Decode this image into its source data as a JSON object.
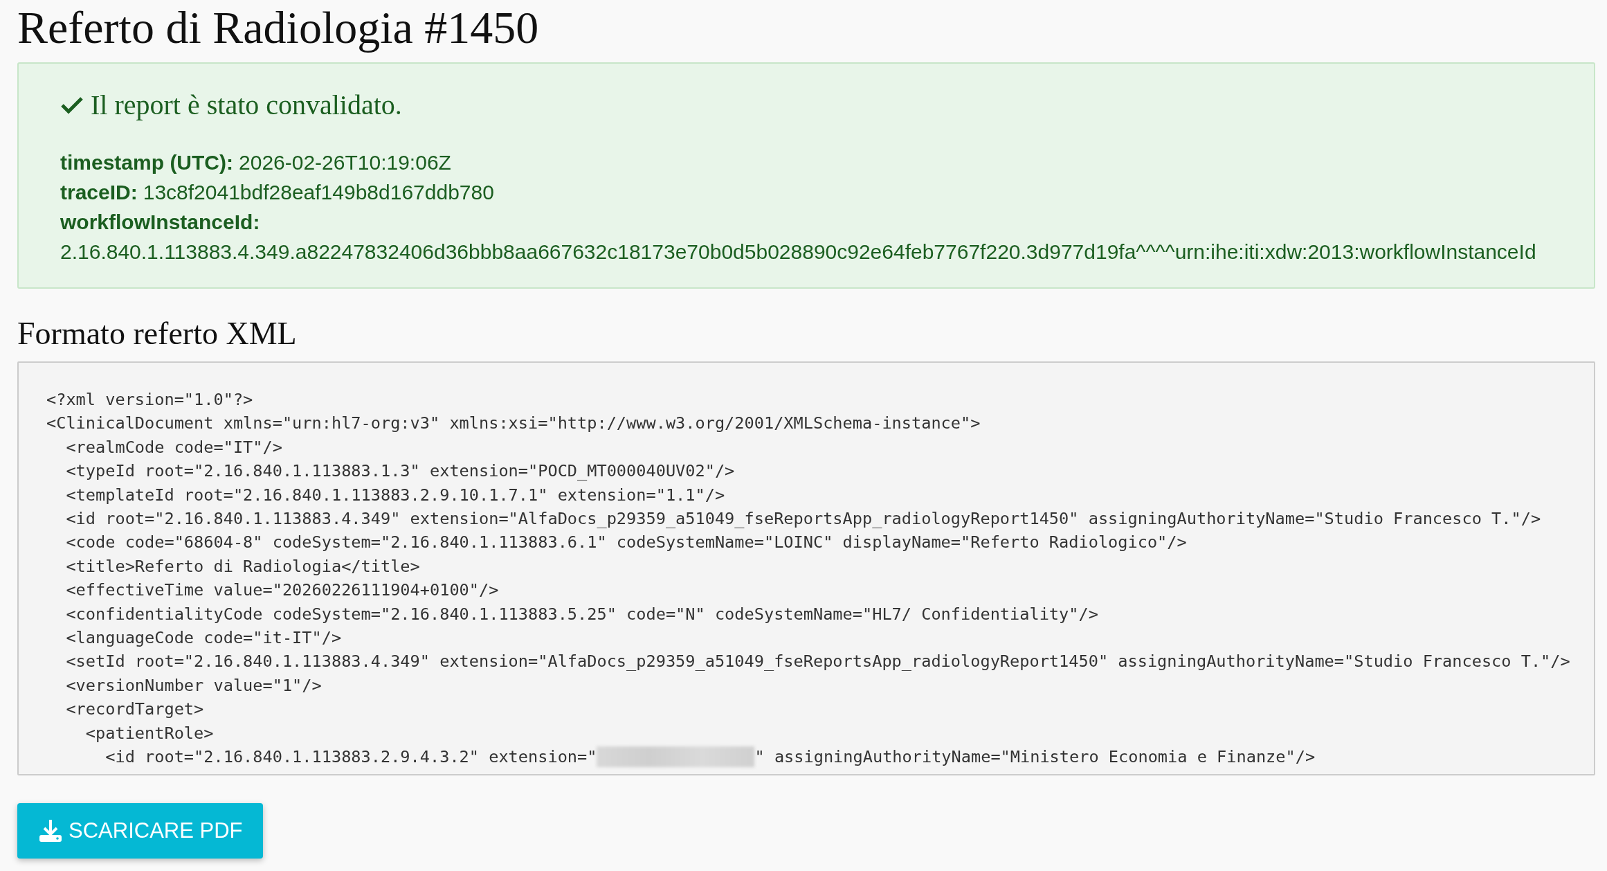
{
  "title": "Referto di Radiologia #1450",
  "alert": {
    "message": "Il report è stato convalidato.",
    "fields": [
      {
        "label": "timestamp (UTC):",
        "value": "2026-02-26T10:19:06Z",
        "wrap": false
      },
      {
        "label": "traceID:",
        "value": "13c8f2041bdf28eaf149b8d167ddb780",
        "wrap": false
      },
      {
        "label": "workflowInstanceId:",
        "value": "2.16.840.1.113883.4.349.a82247832406d36bbb8aa667632c18173e70b0d5b028890c92e64feb7767f220.3d977d19fa^^^^urn:ihe:iti:xdw:2013:workflowInstanceId",
        "wrap": true
      }
    ]
  },
  "xml_section": {
    "heading": "Formato referto XML",
    "lines": [
      {
        "kind": "plain",
        "text": "<?xml version=\"1.0\"?>"
      },
      {
        "kind": "plain",
        "text": "<ClinicalDocument xmlns=\"urn:hl7-org:v3\" xmlns:xsi=\"http://www.w3.org/2001/XMLSchema-instance\">"
      },
      {
        "kind": "plain",
        "text": "  <realmCode code=\"IT\"/>"
      },
      {
        "kind": "plain",
        "text": "  <typeId root=\"2.16.840.1.113883.1.3\" extension=\"POCD_MT000040UV02\"/>"
      },
      {
        "kind": "plain",
        "text": "  <templateId root=\"2.16.840.1.113883.2.9.10.1.7.1\" extension=\"1.1\"/>"
      },
      {
        "kind": "plain",
        "text": "  <id root=\"2.16.840.1.113883.4.349\" extension=\"AlfaDocs_p29359_a51049_fseReportsApp_radiologyReport1450\" assigningAuthorityName=\"Studio Francesco T.\"/>"
      },
      {
        "kind": "plain",
        "text": "  <code code=\"68604-8\" codeSystem=\"2.16.840.1.113883.6.1\" codeSystemName=\"LOINC\" displayName=\"Referto Radiologico\"/>"
      },
      {
        "kind": "plain",
        "text": "  <title>Referto di Radiologia</title>"
      },
      {
        "kind": "plain",
        "text": "  <effectiveTime value=\"20260226111904+0100\"/>"
      },
      {
        "kind": "plain",
        "text": "  <confidentialityCode codeSystem=\"2.16.840.1.113883.5.25\" code=\"N\" codeSystemName=\"HL7/ Confidentiality\"/>"
      },
      {
        "kind": "plain",
        "text": "  <languageCode code=\"it-IT\"/>"
      },
      {
        "kind": "plain",
        "text": "  <setId root=\"2.16.840.1.113883.4.349\" extension=\"AlfaDocs_p29359_a51049_fseReportsApp_radiologyReport1450\" assigningAuthorityName=\"Studio Francesco T.\"/>"
      },
      {
        "kind": "plain",
        "text": "  <versionNumber value=\"1\"/>"
      },
      {
        "kind": "plain",
        "text": "  <recordTarget>"
      },
      {
        "kind": "plain",
        "text": "    <patientRole>"
      },
      {
        "kind": "redacted",
        "text": "      <id root=\"2.16.840.1.113883.2.9.4.3.2\" extension=\"",
        "after": "\" assigningAuthorityName=\"Ministero Economia e Finanze\"/>"
      }
    ]
  },
  "download_button": {
    "label": "SCARICARE PDF"
  }
}
